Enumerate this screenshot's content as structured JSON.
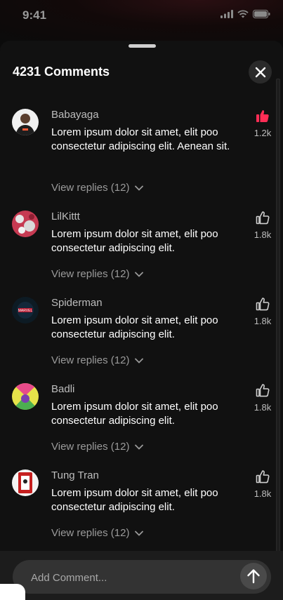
{
  "status": {
    "time": "9:41"
  },
  "header": {
    "title": "4231 Comments"
  },
  "comments": [
    {
      "author": "Babayaga",
      "text": "Lorem ipsum dolor sit amet, elit poo consectetur adipiscing elit. Aenean sit.",
      "replies": "View replies (12)",
      "likes": "1.2k",
      "liked": true
    },
    {
      "author": "LilKittt",
      "text": "Lorem ipsum dolor sit amet, elit poo consectetur adipiscing elit.",
      "replies": "View replies (12)",
      "likes": "1.8k",
      "liked": false
    },
    {
      "author": "Spiderman",
      "text": "Lorem ipsum dolor sit amet, elit poo consectetur adipiscing elit.",
      "replies": "View replies (12)",
      "likes": "1.8k",
      "liked": false
    },
    {
      "author": "Badli",
      "text": "Lorem ipsum dolor sit amet, elit poo consectetur adipiscing elit.",
      "replies": "View replies (12)",
      "likes": "1.8k",
      "liked": false
    },
    {
      "author": "Tung Tran",
      "text": "Lorem ipsum dolor sit amet, elit poo consectetur adipiscing elit.",
      "replies": "View replies (12)",
      "likes": "1.8k",
      "liked": false
    }
  ],
  "composer": {
    "placeholder": "Add Comment..."
  },
  "colors": {
    "like_active": "#ff2d55",
    "sheet_bg": "#111111"
  },
  "icons": {
    "close": "close-icon",
    "like": "thumbs-up-icon",
    "send": "arrow-up-icon",
    "expand": "chevron-down-icon"
  }
}
